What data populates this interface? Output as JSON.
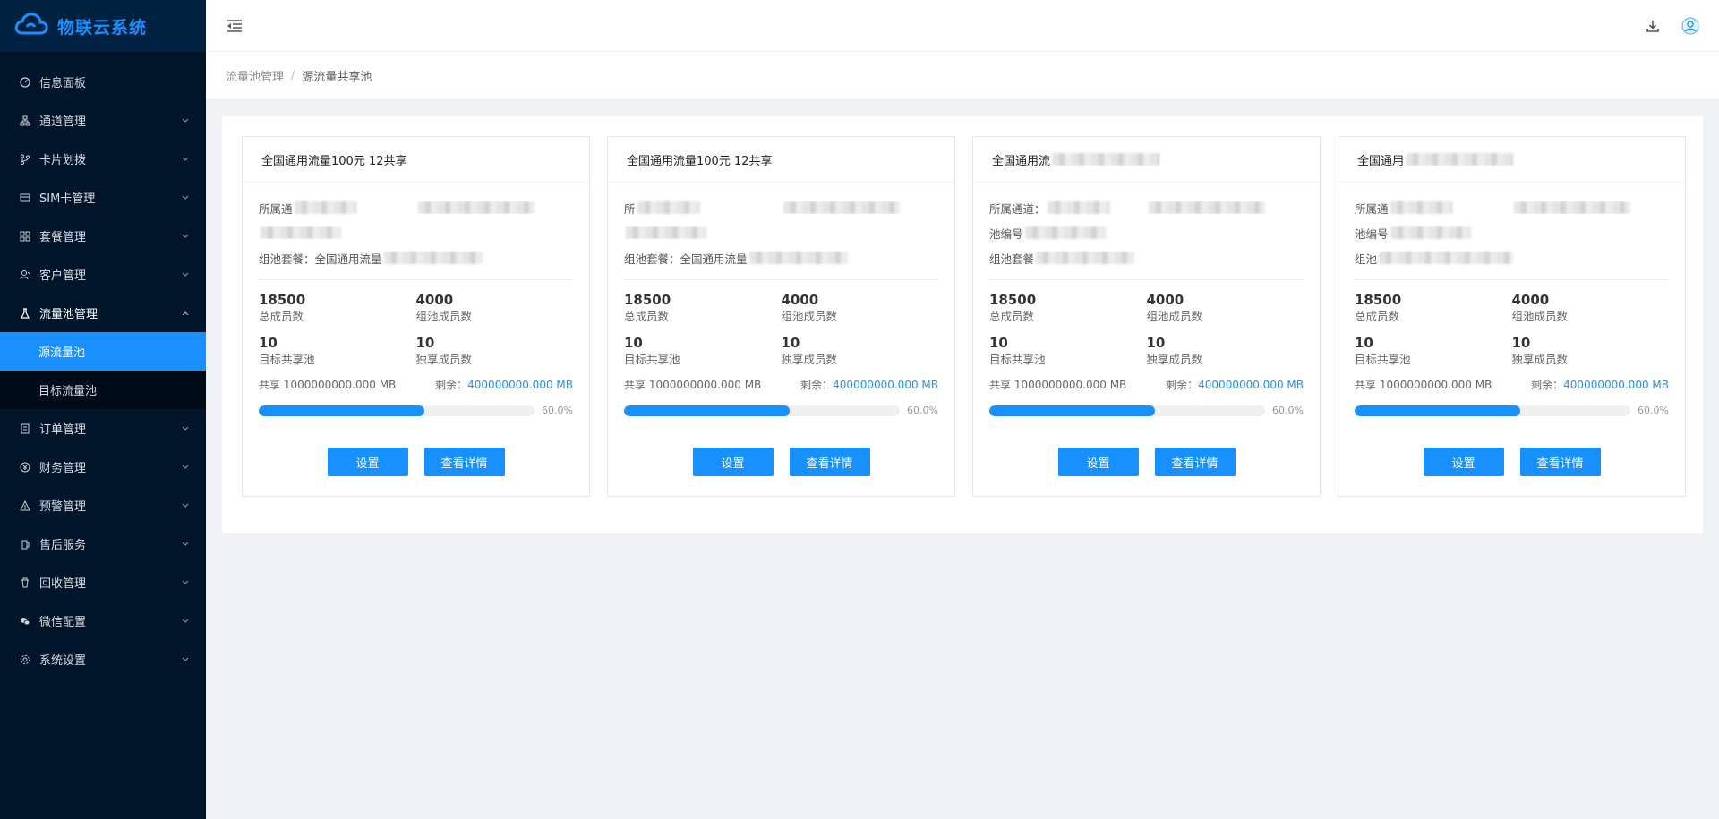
{
  "app": {
    "name": "物联云系统"
  },
  "sidebar": {
    "items": [
      {
        "label": "信息面板",
        "icon": "dashboard-icon"
      },
      {
        "label": "通道管理",
        "icon": "network-icon"
      },
      {
        "label": "卡片划拨",
        "icon": "branch-icon"
      },
      {
        "label": "SIM卡管理",
        "icon": "card-icon"
      },
      {
        "label": "套餐管理",
        "icon": "grid-icon"
      },
      {
        "label": "客户管理",
        "icon": "user-icon"
      },
      {
        "label": "流量池管理",
        "icon": "flask-icon"
      }
    ],
    "sub_items": [
      {
        "label": "源流量池",
        "active": true
      },
      {
        "label": "目标流量池",
        "active": false
      }
    ],
    "items_after": [
      {
        "label": "订单管理",
        "icon": "order-icon"
      },
      {
        "label": "财务管理",
        "icon": "finance-icon"
      },
      {
        "label": "预警管理",
        "icon": "warning-icon"
      },
      {
        "label": "售后服务",
        "icon": "service-icon"
      },
      {
        "label": "回收管理",
        "icon": "trash-icon"
      },
      {
        "label": "微信配置",
        "icon": "wechat-icon"
      },
      {
        "label": "系统设置",
        "icon": "gear-icon"
      }
    ]
  },
  "breadcrumb": {
    "parent": "流量池管理",
    "separator": "/",
    "current": "源流量共享池"
  },
  "cards": [
    {
      "title": "全国通用流量100元 12共享",
      "channel_label": "所属通",
      "pool_label": "",
      "package_label": "组池套餐：全国通用流量",
      "total_members": "18500",
      "total_members_label": "总成员数",
      "pool_members": "4000",
      "pool_members_label": "组池成员数",
      "target_share": "10",
      "target_share_label": "目标共享池",
      "exclusive": "10",
      "exclusive_label": "独享成员数",
      "share_text": "共享 1000000000.000 MB",
      "remain_label": "剩余：",
      "remain_value": "400000000.000 MB",
      "progress": 0.6,
      "progress_text": "60.0%",
      "set_label": "设置",
      "detail_label": "查看详情"
    },
    {
      "title": "全国通用流量100元 12共享",
      "channel_label": "所",
      "pool_label": "",
      "package_label": "组池套餐：全国通用流量",
      "total_members": "18500",
      "total_members_label": "总成员数",
      "pool_members": "4000",
      "pool_members_label": "组池成员数",
      "target_share": "10",
      "target_share_label": "目标共享池",
      "exclusive": "10",
      "exclusive_label": "独享成员数",
      "share_text": "共享 1000000000.000 MB",
      "remain_label": "剩余：",
      "remain_value": "400000000.000 MB",
      "progress": 0.6,
      "progress_text": "60.0%",
      "set_label": "设置",
      "detail_label": "查看详情"
    },
    {
      "title": "全国通用流",
      "channel_label": "所属通道：",
      "pool_label": "池编号",
      "package_label": "组池套餐",
      "total_members": "18500",
      "total_members_label": "总成员数",
      "pool_members": "4000",
      "pool_members_label": "组池成员数",
      "target_share": "10",
      "target_share_label": "目标共享池",
      "exclusive": "10",
      "exclusive_label": "独享成员数",
      "share_text": "共享 1000000000.000 MB",
      "remain_label": "剩余：",
      "remain_value": "400000000.000 MB",
      "progress": 0.6,
      "progress_text": "60.0%",
      "set_label": "设置",
      "detail_label": "查看详情"
    },
    {
      "title": "全国通用",
      "channel_label": "所属通",
      "pool_label": "池编号",
      "package_label": "组池",
      "total_members": "18500",
      "total_members_label": "总成员数",
      "pool_members": "4000",
      "pool_members_label": "组池成员数",
      "target_share": "10",
      "target_share_label": "目标共享池",
      "exclusive": "10",
      "exclusive_label": "独享成员数",
      "share_text": "共享 1000000000.000 MB",
      "remain_label": "剩余：",
      "remain_value": "400000000.000 MB",
      "progress": 0.6,
      "progress_text": "60.0%",
      "set_label": "设置",
      "detail_label": "查看详情"
    }
  ],
  "colors": {
    "sidebar_bg": "#001529",
    "accent": "#1890ff",
    "page_bg": "#f0f2f5"
  }
}
